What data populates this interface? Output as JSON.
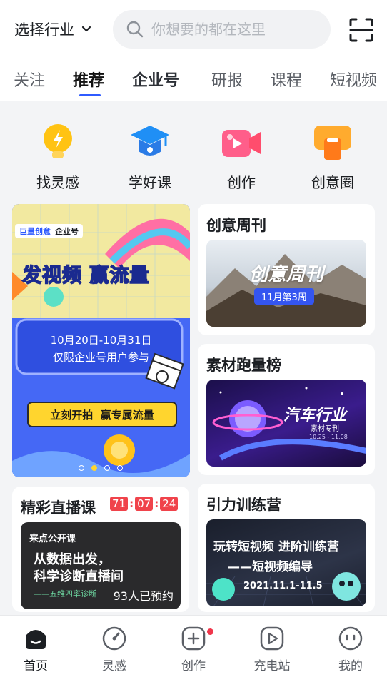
{
  "header": {
    "industry_label": "选择行业",
    "search_placeholder": "你想要的都在这里"
  },
  "tabs": [
    {
      "label": "关注"
    },
    {
      "label": "推荐"
    },
    {
      "label": "企业号"
    },
    {
      "label": "研报"
    },
    {
      "label": "课程"
    },
    {
      "label": "短视频"
    }
  ],
  "shortcuts": [
    {
      "label": "找灵感",
      "icon": "lightbulb-icon"
    },
    {
      "label": "学好课",
      "icon": "graduation-cap-icon"
    },
    {
      "label": "创作",
      "icon": "video-camera-icon"
    },
    {
      "label": "创意圈",
      "icon": "chat-circle-icon"
    }
  ],
  "banner": {
    "brand_left": "巨量创意",
    "brand_right": "企业号",
    "headline": "发视频 赢流量",
    "date_range": "10月20日-10月31日",
    "eligibility": "仅限企业号用户参与",
    "cta": "立刻开拍  赢专属流量"
  },
  "cards": {
    "weekly": {
      "title": "创意周刊",
      "thumb_title": "创意周刊",
      "thumb_badge": "11月第3周"
    },
    "ranking": {
      "title": "素材跑量榜",
      "thumb_title": "汽车行业",
      "thumb_sub": "素材专刊",
      "thumb_date": "10.25 - 11.08"
    },
    "live": {
      "title": "精彩直播课",
      "countdown": [
        "71",
        "07",
        "24"
      ],
      "thumb_tag": "来点公开课",
      "thumb_line1": "从数据出发，",
      "thumb_line2": "科学诊断直播间",
      "thumb_line3": "——五维四率诊断",
      "reservations": "93人已预约"
    },
    "camp": {
      "title": "引力训练营",
      "thumb_line1": "玩转短视频 进阶训练营",
      "thumb_line2": "——短视频编导",
      "thumb_date": "2021.11.1-11.5"
    }
  },
  "bottom_nav": [
    {
      "label": "首页",
      "icon": "home-icon"
    },
    {
      "label": "灵感",
      "icon": "compass-icon"
    },
    {
      "label": "创作",
      "icon": "create-plus-icon"
    },
    {
      "label": "充电站",
      "icon": "play-station-icon"
    },
    {
      "label": "我的",
      "icon": "profile-icon"
    }
  ],
  "colors": {
    "accent": "#2f5bff",
    "badge_red": "#f0364b",
    "countdown_red": "#f0434b"
  }
}
